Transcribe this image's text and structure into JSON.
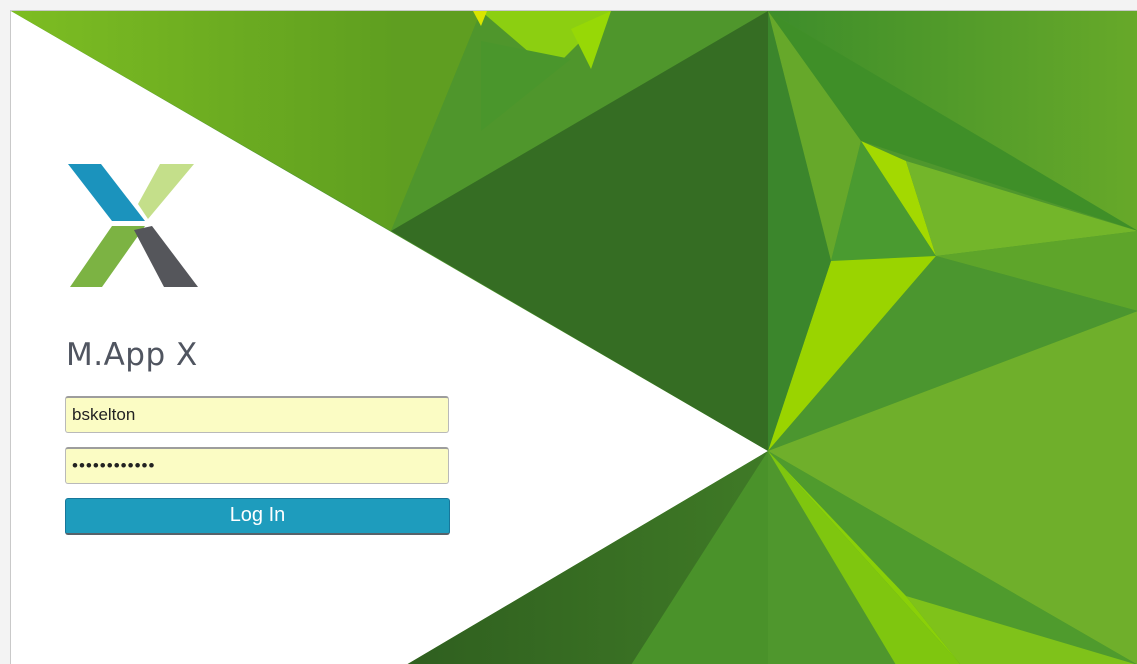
{
  "app": {
    "title": "M.App X"
  },
  "login": {
    "username_value": "bskelton",
    "password_value": "••••••••••••",
    "submit_label": "Log In"
  },
  "colors": {
    "brand_blue": "#1e9cbd",
    "input_background": "#fbfcc4",
    "background_greens": [
      "#75b82b",
      "#4e9a2e",
      "#3c7328",
      "#9ad400"
    ]
  },
  "icons": {
    "logo": "hexagon-mappx-logo-icon"
  }
}
